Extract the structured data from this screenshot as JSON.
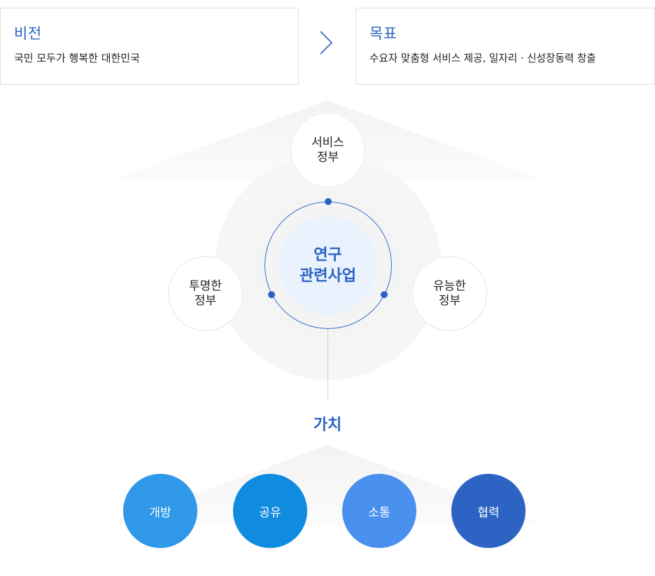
{
  "vision": {
    "title": "비전",
    "description": "국민 모두가 행복한 대한민국"
  },
  "goal": {
    "title": "목표",
    "description": "수요자 맞춤형 서비스 제공, 일자리 · 신성장동력 창출"
  },
  "center": {
    "label": "연구\n관련사업"
  },
  "nodes": {
    "top": "서비스\n정부",
    "left": "투명한\n정부",
    "right": "유능한\n정부"
  },
  "values": {
    "title": "가치",
    "items": [
      {
        "label": "개방",
        "color": "#2f98e8"
      },
      {
        "label": "공유",
        "color": "#0f8ce0"
      },
      {
        "label": "소통",
        "color": "#4a90ef"
      },
      {
        "label": "협력",
        "color": "#2d64c4"
      }
    ]
  },
  "colors": {
    "accent": "#2b63c4",
    "center_fill": "#e9f2fd"
  }
}
